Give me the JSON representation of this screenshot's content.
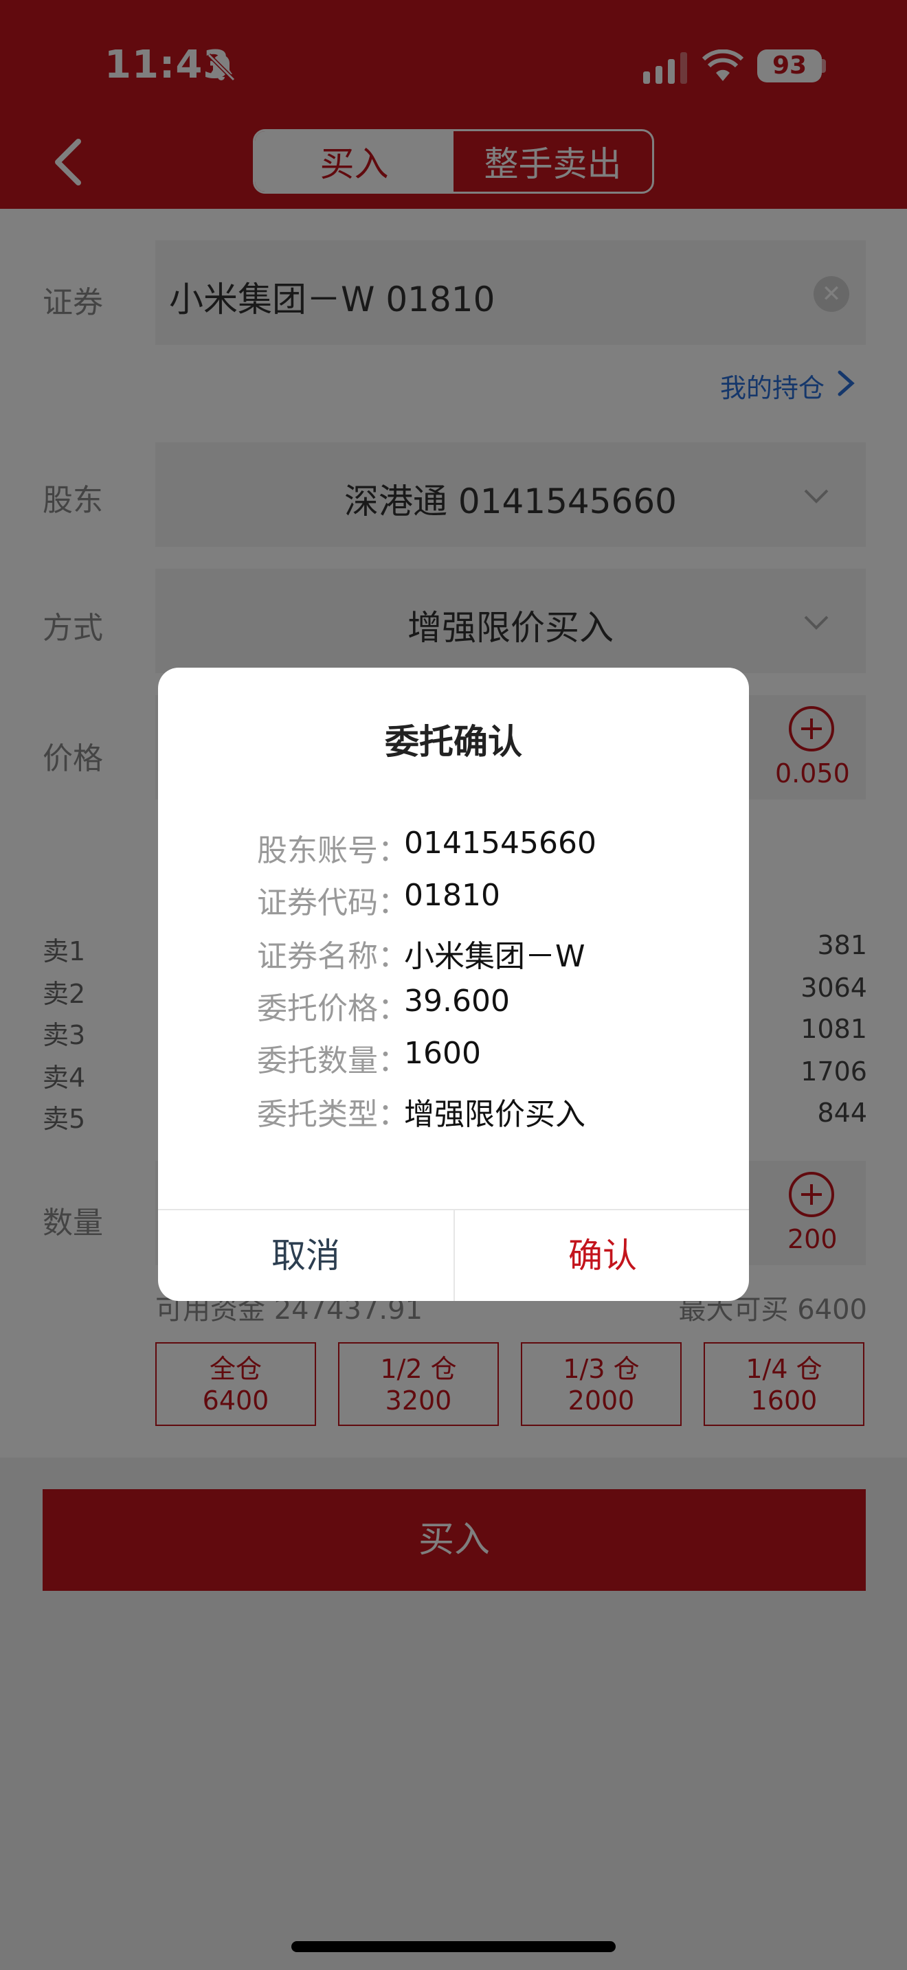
{
  "status_bar": {
    "time": "11:43",
    "battery": "93"
  },
  "tabs": [
    {
      "label": "买入"
    },
    {
      "label": "整手卖出"
    }
  ],
  "form": {
    "security_label": "证券",
    "security_value": "小米集团－W  01810",
    "holdings_link": "我的持仓",
    "holder_label": "股东",
    "holder_value": "深港通 0141545660",
    "method_label": "方式",
    "method_value": "增强限价买入",
    "price_label": "价格",
    "price_step": "0.050",
    "quantity_label": "数量",
    "quantity_step": "200"
  },
  "asks": [
    {
      "label": "卖1",
      "volume": "381"
    },
    {
      "label": "卖2",
      "volume": "3064"
    },
    {
      "label": "卖3",
      "volume": "1081"
    },
    {
      "label": "卖4",
      "volume": "1706"
    },
    {
      "label": "卖5",
      "volume": "844"
    }
  ],
  "funds": {
    "available": "可用资金 247437.91",
    "max_buy": "最大可买 6400"
  },
  "positions": [
    {
      "name": "全仓",
      "qty": "6400"
    },
    {
      "name": "1/2 仓",
      "qty": "3200"
    },
    {
      "name": "1/3 仓",
      "qty": "2000"
    },
    {
      "name": "1/4 仓",
      "qty": "1600"
    }
  ],
  "buy_button": "买入",
  "dialog": {
    "title": "委托确认",
    "rows": [
      {
        "key": "股东账号：",
        "value": "0141545660"
      },
      {
        "key": "证券代码：",
        "value": "01810"
      },
      {
        "key": "证券名称：",
        "value": "小米集团－W"
      },
      {
        "key": "委托价格：",
        "value": "39.600"
      },
      {
        "key": "委托数量：",
        "value": "1600"
      },
      {
        "key": "委托类型：",
        "value": "增强限价买入"
      }
    ],
    "cancel": "取消",
    "confirm": "确认"
  },
  "colors": {
    "brand_red": "#c3141c",
    "link_blue": "#2a6fd6"
  }
}
